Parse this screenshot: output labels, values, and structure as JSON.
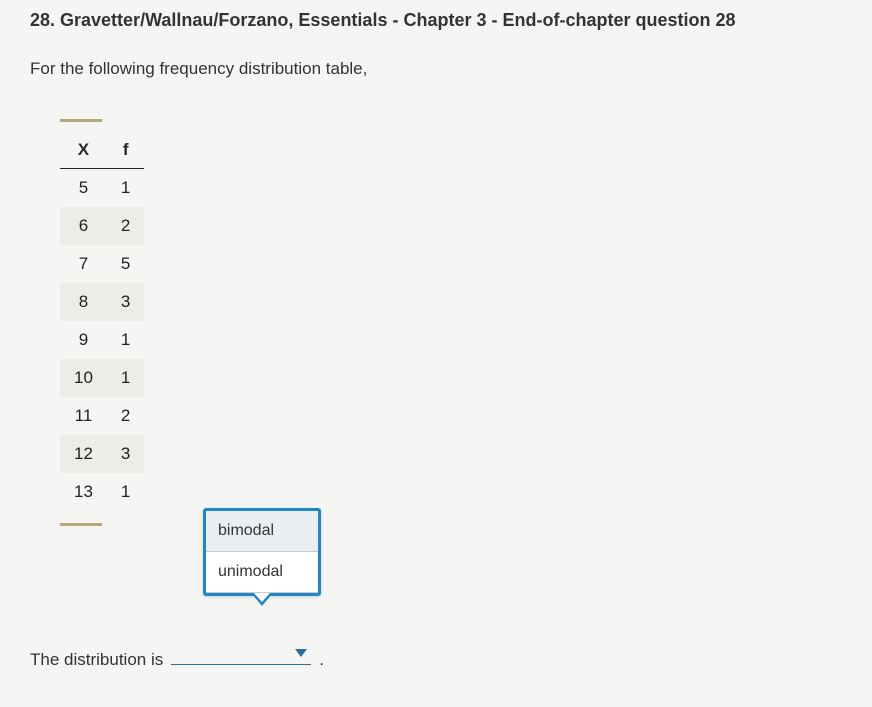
{
  "title": "28. Gravetter/Wallnau/Forzano, Essentials - Chapter 3 - End-of-chapter question 28",
  "prompt": "For the following frequency distribution table,",
  "table": {
    "headers": {
      "x": "X",
      "f": "f"
    },
    "rows": [
      {
        "x": "5",
        "f": "1",
        "shaded": false
      },
      {
        "x": "6",
        "f": "2",
        "shaded": true
      },
      {
        "x": "7",
        "f": "5",
        "shaded": false
      },
      {
        "x": "8",
        "f": "3",
        "shaded": true
      },
      {
        "x": "9",
        "f": "1",
        "shaded": false
      },
      {
        "x": "10",
        "f": "1",
        "shaded": true
      },
      {
        "x": "11",
        "f": "2",
        "shaded": false
      },
      {
        "x": "12",
        "f": "3",
        "shaded": true
      },
      {
        "x": "13",
        "f": "1",
        "shaded": false
      }
    ]
  },
  "dropdown": {
    "options": [
      "bimodal",
      "unimodal"
    ]
  },
  "answer": {
    "lead": "The distribution is",
    "period": "."
  }
}
